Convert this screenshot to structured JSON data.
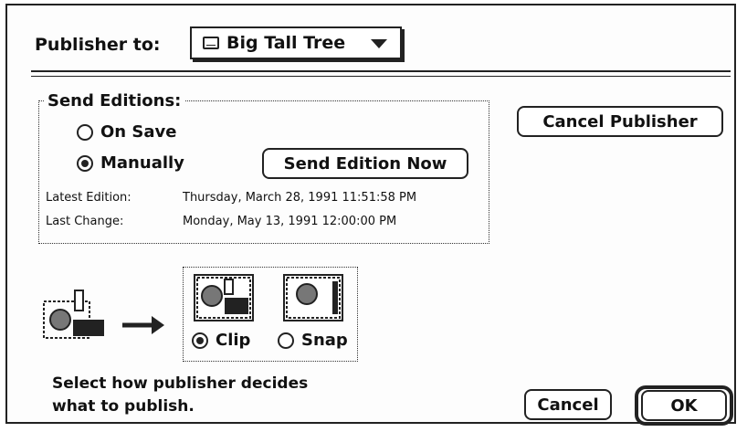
{
  "publisher": {
    "label": "Publisher to:",
    "selected": "Big Tall Tree"
  },
  "send_editions": {
    "title": "Send Editions:",
    "options": [
      "On Save",
      "Manually"
    ],
    "selected": "Manually",
    "send_now_label": "Send Edition Now",
    "latest_edition_label": "Latest Edition:",
    "latest_edition_value": "Thursday, March 28, 1991 11:51:58 PM",
    "last_change_label": "Last Change:",
    "last_change_value": "Monday, May 13, 1991 12:00:00 PM"
  },
  "cancel_publisher_label": "Cancel Publisher",
  "format": {
    "options": [
      "Clip",
      "Snap"
    ],
    "selected": "Clip"
  },
  "hint": {
    "line1": "Select how publisher decides",
    "line2": "what to publish."
  },
  "buttons": {
    "cancel": "Cancel",
    "ok": "OK"
  },
  "icons": [
    "volume-icon",
    "popup-arrow-icon",
    "radio-icon",
    "publisher-illustration-icon",
    "clip-icon",
    "snap-icon"
  ]
}
